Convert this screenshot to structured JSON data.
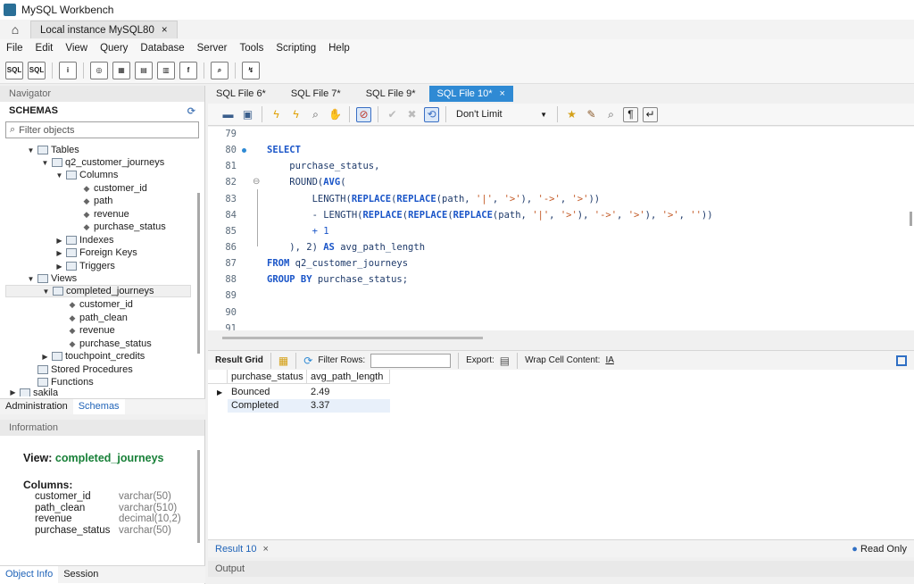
{
  "window": {
    "title": "MySQL Workbench"
  },
  "instance_tab": {
    "label": "Local instance MySQL80",
    "close": "×"
  },
  "menu": [
    "File",
    "Edit",
    "View",
    "Query",
    "Database",
    "Server",
    "Tools",
    "Scripting",
    "Help"
  ],
  "navigator": {
    "header": "Navigator",
    "schemas_title": "SCHEMAS",
    "filter_placeholder": "Filter objects",
    "tree": {
      "tables": "Tables",
      "q2": "q2_customer_journeys",
      "columns": "Columns",
      "q2_cols": [
        "customer_id",
        "path",
        "revenue",
        "purchase_status"
      ],
      "indexes": "Indexes",
      "foreign_keys": "Foreign Keys",
      "triggers": "Triggers",
      "views": "Views",
      "completed": "completed_journeys",
      "view_cols": [
        "customer_id",
        "path_clean",
        "revenue",
        "purchase_status"
      ],
      "touchpoint": "touchpoint_credits",
      "stored_procedures": "Stored Procedures",
      "functions": "Functions",
      "sakila": "sakila"
    },
    "tabs": [
      "Administration",
      "Schemas"
    ]
  },
  "information": {
    "header": "Information",
    "view_label": "View:",
    "view_name": "completed_journeys",
    "columns_label": "Columns:",
    "columns": [
      {
        "name": "customer_id",
        "type": "varchar(50)"
      },
      {
        "name": "path_clean",
        "type": "varchar(510)"
      },
      {
        "name": "revenue",
        "type": "decimal(10,2)"
      },
      {
        "name": "purchase_status",
        "type": "varchar(50)"
      }
    ],
    "tabs": [
      "Object Info",
      "Session"
    ]
  },
  "file_tabs": [
    "SQL File 6*",
    "SQL File 7*",
    "SQL File 9*",
    "SQL File 10*"
  ],
  "active_file_close": "×",
  "sql_toolbar": {
    "limit": "Don't Limit"
  },
  "editor": {
    "line_numbers": [
      "79",
      "80",
      "81",
      "82",
      "83",
      "84",
      "85",
      "86",
      "87",
      "88",
      "89",
      "90",
      "91"
    ],
    "lines": {
      "l80": "SELECT",
      "l81": "    purchase_status,",
      "l82a": "    ROUND(",
      "l82b": "AVG",
      "l82c": "(",
      "l83a": "        LENGTH(",
      "l83b": "REPLACE",
      "l83c": "(",
      "l83d": "REPLACE",
      "l83e": "(path, ",
      "l83f": "'|'",
      "l83g": ", ",
      "l83h": "'>'",
      "l83i": "), ",
      "l83j": "'->'",
      "l83k": ", ",
      "l83l": "'>'",
      "l83m": "))",
      "l84a": "        - LENGTH(",
      "l84b": "REPLACE",
      "l84c": "(",
      "l84d": "REPLACE",
      "l84e": "(",
      "l84f": "REPLACE",
      "l84g": "(path, ",
      "l84h": "'|'",
      "l84i": ", ",
      "l84j": "'>'",
      "l84k": "), ",
      "l84l": "'->'",
      "l84m": ", ",
      "l84n": "'>'",
      "l84o": "), ",
      "l84p": "'>'",
      "l84q": ", ",
      "l84r": "''",
      "l84s": "))",
      "l85": "        + 1",
      "l86a": "    ), 2) ",
      "l86b": "AS",
      "l86c": " avg_path_length",
      "l87a": "FROM",
      "l87b": " q2_customer_journeys",
      "l88a": "GROUP BY",
      "l88b": " purchase_status;"
    }
  },
  "result_bar": {
    "result_grid": "Result Grid",
    "filter_rows": "Filter Rows:",
    "export": "Export:",
    "wrap": "Wrap Cell Content:"
  },
  "result_grid": {
    "columns": [
      "purchase_status",
      "avg_path_length"
    ],
    "rows": [
      [
        "Bounced",
        "2.49"
      ],
      [
        "Completed",
        "3.37"
      ]
    ]
  },
  "result_tab": {
    "label": "Result 10",
    "close": "×",
    "read_only": "Read Only"
  },
  "output": {
    "label": "Output"
  }
}
